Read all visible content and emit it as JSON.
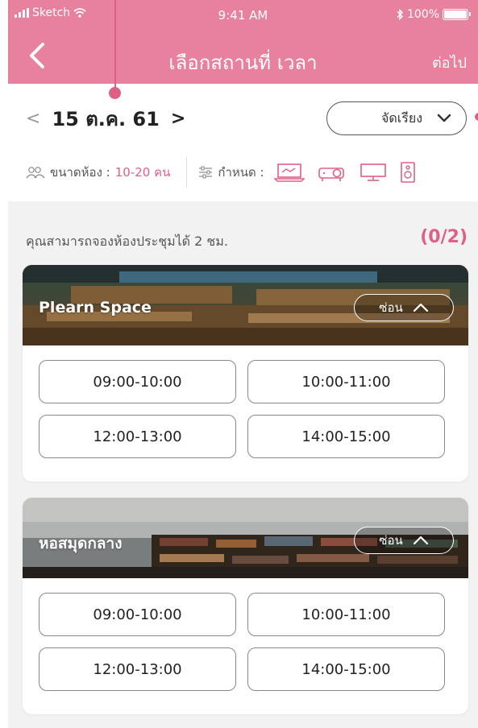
{
  "status_bar": {
    "carrier": "Sketch",
    "time": "9:41 AM",
    "battery": "100%"
  },
  "nav": {
    "title": "เลือกสถานที่ เวลา",
    "next_label": "ต่อไป"
  },
  "date": {
    "prev": "<",
    "label": "15 ต.ค. 61",
    "next": ">"
  },
  "sort": {
    "label": "จัดเรียง"
  },
  "filters": {
    "size_label": "ขนาดห้อง :",
    "size_value": "10-20 คน",
    "equipment_label": "กำหนด :",
    "equipment_icons": [
      "laptop-icon",
      "projector-icon",
      "monitor-icon",
      "speaker-icon"
    ]
  },
  "quota": {
    "text": "คุณสามารถจองห้องประชุมได้ 2 ชม.",
    "count": "(0/2)"
  },
  "venues": [
    {
      "name": "Plearn Space",
      "toggle_label": "ซ่อน",
      "slots": [
        "09:00-10:00",
        "10:00-11:00",
        "12:00-13:00",
        "14:00-15:00"
      ]
    },
    {
      "name": "หอสมุดกลาง",
      "toggle_label": "ซ่อน",
      "slots": [
        "09:00-10:00",
        "10:00-11:00",
        "12:00-13:00",
        "14:00-15:00"
      ]
    }
  ],
  "colors": {
    "accent": "#e8819d",
    "highlight": "#e05f86"
  }
}
